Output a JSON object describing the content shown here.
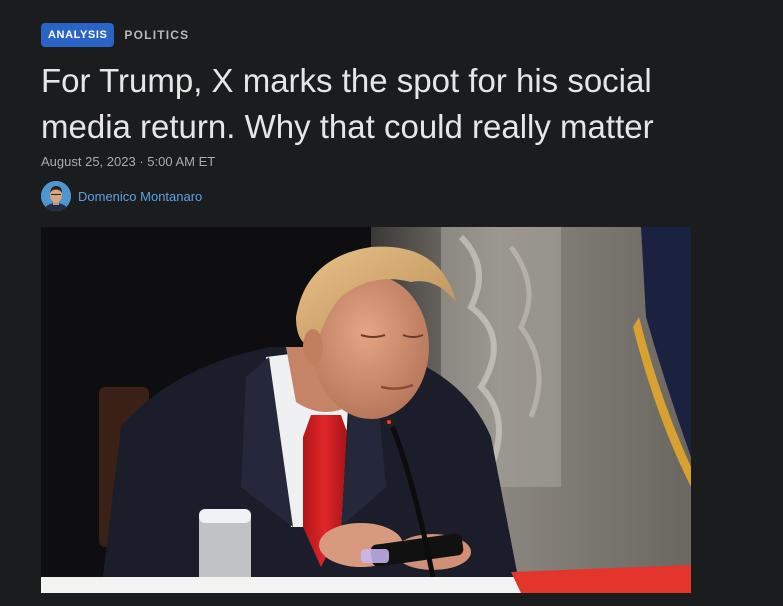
{
  "article": {
    "tags": {
      "primary": "ANALYSIS",
      "section": "POLITICS"
    },
    "headline": "For Trump, X marks the spot for his social media return. Why that could really matter",
    "date": "August 25, 2023",
    "separator": "·",
    "time": "5:00 AM ET",
    "author": "Domenico Montanaro"
  },
  "colors": {
    "background": "#1b1c1e",
    "tag_accent": "#2a64c6",
    "headline": "#e6e6e6",
    "author_link": "#5aa2e6"
  },
  "icons": {
    "avatar": "author-avatar-photo",
    "hero": "article-hero-photo"
  }
}
